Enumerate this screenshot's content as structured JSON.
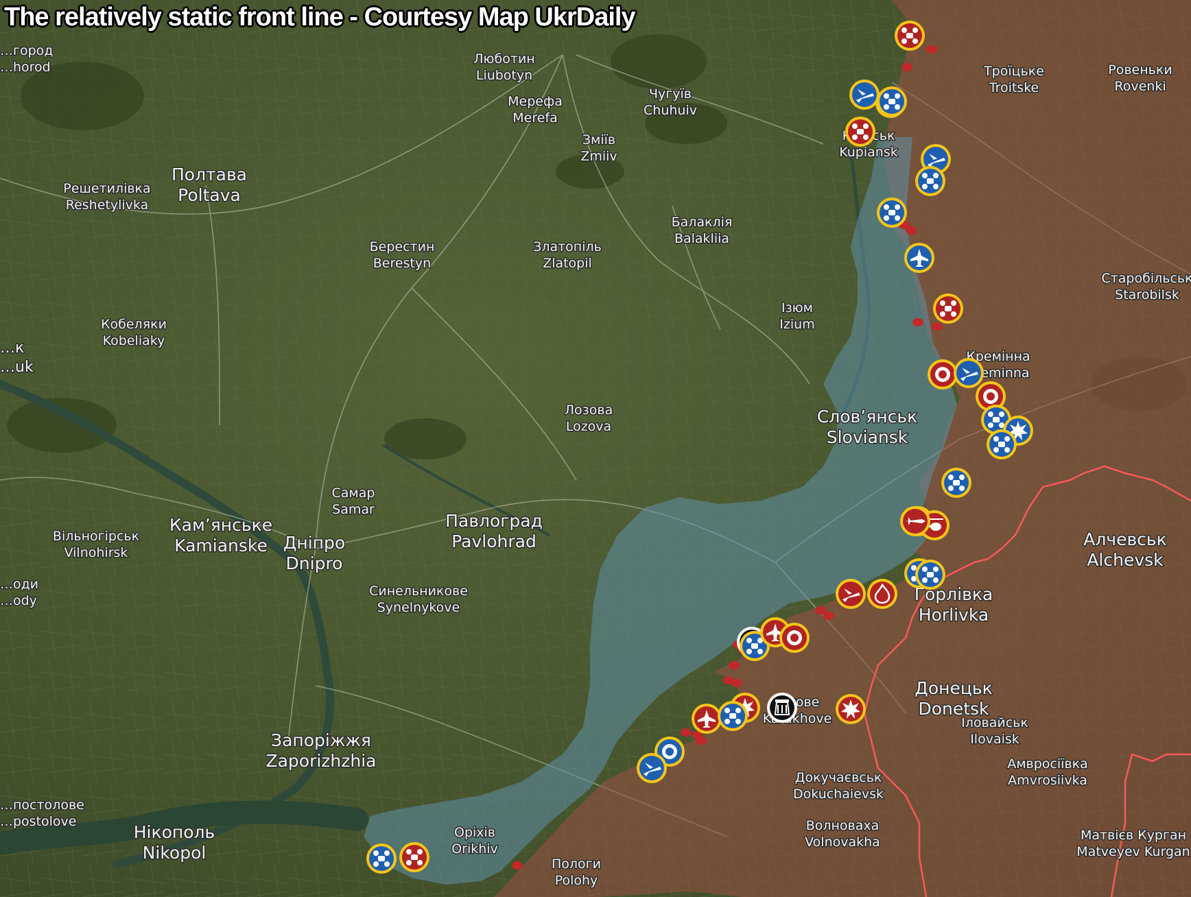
{
  "title": "The relatively static front line - Courtesy Map UkrDaily",
  "colors": {
    "terrain": "#46552f",
    "ukraine_held_overlay": "#5f8fa8",
    "russia_held_overlay": "#9b5044",
    "border_line": "#ff5a5a",
    "front_dot": "#c0282a",
    "marker_blue": "#1f5fb0",
    "marker_red": "#b02323",
    "marker_black": "#111111",
    "marker_ring": "#f5c518"
  },
  "places": [
    {
      "id": "bilhorod",
      "uk": "…город",
      "en": "…horod"
    },
    {
      "id": "liubotyn",
      "uk": "Люботин",
      "en": "Liubotyn"
    },
    {
      "id": "merefa",
      "uk": "Мерефа",
      "en": "Merefa"
    },
    {
      "id": "chuhuiv",
      "uk": "Чугуїв",
      "en": "Chuhuiv"
    },
    {
      "id": "zmiiv",
      "uk": "Зміїв",
      "en": "Zmiiv"
    },
    {
      "id": "kupiansk",
      "uk": "Ку…ськ",
      "en": "Kupiansk"
    },
    {
      "id": "troitske",
      "uk": "Троїцьке",
      "en": "Troitske"
    },
    {
      "id": "rovenky",
      "uk": "Ровеньки",
      "en": "Rovenki"
    },
    {
      "id": "reshetylivka",
      "uk": "Решетилівка",
      "en": "Reshetylivka"
    },
    {
      "id": "poltava",
      "uk": "Полтава",
      "en": "Poltava"
    },
    {
      "id": "balakliia",
      "uk": "Балаклія",
      "en": "Balakliia"
    },
    {
      "id": "berestyn",
      "uk": "Берестин",
      "en": "Berestyn"
    },
    {
      "id": "zlatopil",
      "uk": "Златопіль",
      "en": "Zlatopil"
    },
    {
      "id": "starobilsk",
      "uk": "Старобільськ",
      "en": "Starobilsk"
    },
    {
      "id": "kobeliaky",
      "uk": "Кобеляки",
      "en": "Kobeliaky"
    },
    {
      "id": "izium",
      "uk": "Ізюм",
      "en": "Izium"
    },
    {
      "id": "kremenna",
      "uk": "Кремінна",
      "en": "Kreminna"
    },
    {
      "id": "kremenchuk",
      "uk": "…к",
      "en": "…uk"
    },
    {
      "id": "lozova",
      "uk": "Лозова",
      "en": "Lozova"
    },
    {
      "id": "sloviansk",
      "uk": "Слов’янськ",
      "en": "Sloviansk"
    },
    {
      "id": "samar",
      "uk": "Самар",
      "en": "Samar"
    },
    {
      "id": "pavlohrad",
      "uk": "Павлоград",
      "en": "Pavlohrad"
    },
    {
      "id": "kamianske",
      "uk": "Кам’янське",
      "en": "Kamianske"
    },
    {
      "id": "dnipro",
      "uk": "Дніпро",
      "en": "Dnipro"
    },
    {
      "id": "vilnohirsk",
      "uk": "Вільногірськ",
      "en": "Vilnohirsk"
    },
    {
      "id": "alchevsk",
      "uk": "Алчевськ",
      "en": "Alchevsk"
    },
    {
      "id": "zhovti_vody",
      "uk": "…оди",
      "en": "…ody"
    },
    {
      "id": "synelnykove",
      "uk": "Синельникове",
      "en": "Synelnykove"
    },
    {
      "id": "horlivka",
      "uk": "Горлівка",
      "en": "Horlivka"
    },
    {
      "id": "donetsk",
      "uk": "Донецьк",
      "en": "Donetsk"
    },
    {
      "id": "kurakhove",
      "uk": "…хове",
      "en": "Kurakhove"
    },
    {
      "id": "ilovaisk",
      "uk": "Іловайськ",
      "en": "Ilovaisk"
    },
    {
      "id": "zaporizhzhia",
      "uk": "Запоріжжя",
      "en": "Zaporizhzhia"
    },
    {
      "id": "amvrosiivka",
      "uk": "Амвросіївка",
      "en": "Amvrosiivka"
    },
    {
      "id": "dokuchaievsk",
      "uk": "Докучаєвськ",
      "en": "Dokuchaievsk"
    },
    {
      "id": "apostolove",
      "uk": "…постолове",
      "en": "…postolove"
    },
    {
      "id": "volnovakha",
      "uk": "Волноваха",
      "en": "Volnovakha"
    },
    {
      "id": "nikopol",
      "uk": "Нікополь",
      "en": "Nikopol"
    },
    {
      "id": "orikhiv",
      "uk": "Оріхів",
      "en": "Orikhiv"
    },
    {
      "id": "matveyev_kurgan",
      "uk": "Матвієв Курган",
      "en": "Matveyev Kurgan"
    },
    {
      "id": "polohy",
      "uk": "Пологи",
      "en": "Polohy"
    }
  ],
  "markers": [
    {
      "color": "red",
      "icon": "drone"
    },
    {
      "color": "blue",
      "icon": "jet"
    },
    {
      "color": "blue",
      "icon": "drone"
    },
    {
      "color": "blue",
      "icon": "drone"
    },
    {
      "color": "red",
      "icon": "drone"
    },
    {
      "color": "blue",
      "icon": "jet"
    },
    {
      "color": "blue",
      "icon": "drone"
    },
    {
      "color": "blue",
      "icon": "drone"
    },
    {
      "color": "blue",
      "icon": "plane"
    },
    {
      "color": "red",
      "icon": "drone"
    },
    {
      "color": "red",
      "icon": "target"
    },
    {
      "color": "blue",
      "icon": "jet"
    },
    {
      "color": "red",
      "icon": "target"
    },
    {
      "color": "blue",
      "icon": "drone"
    },
    {
      "color": "blue",
      "icon": "explosion"
    },
    {
      "color": "blue",
      "icon": "drone"
    },
    {
      "color": "blue",
      "icon": "drone"
    },
    {
      "color": "red",
      "icon": "missile"
    },
    {
      "color": "red",
      "icon": "helicopter"
    },
    {
      "color": "red",
      "icon": "missile"
    },
    {
      "color": "blue",
      "icon": "drone"
    },
    {
      "color": "blue",
      "icon": "drone"
    },
    {
      "color": "red",
      "icon": "jet"
    },
    {
      "color": "red",
      "icon": "fire"
    },
    {
      "color": "black",
      "icon": "explosion"
    },
    {
      "color": "blue",
      "icon": "drone"
    },
    {
      "color": "red",
      "icon": "plane"
    },
    {
      "color": "red",
      "icon": "target"
    },
    {
      "color": "red",
      "icon": "explosion"
    },
    {
      "color": "red",
      "icon": "plane"
    },
    {
      "color": "blue",
      "icon": "drone"
    },
    {
      "color": "black",
      "icon": "dam"
    },
    {
      "color": "red",
      "icon": "explosion"
    },
    {
      "color": "blue",
      "icon": "target"
    },
    {
      "color": "blue",
      "icon": "jet"
    },
    {
      "color": "blue",
      "icon": "drone"
    },
    {
      "color": "red",
      "icon": "drone"
    }
  ]
}
